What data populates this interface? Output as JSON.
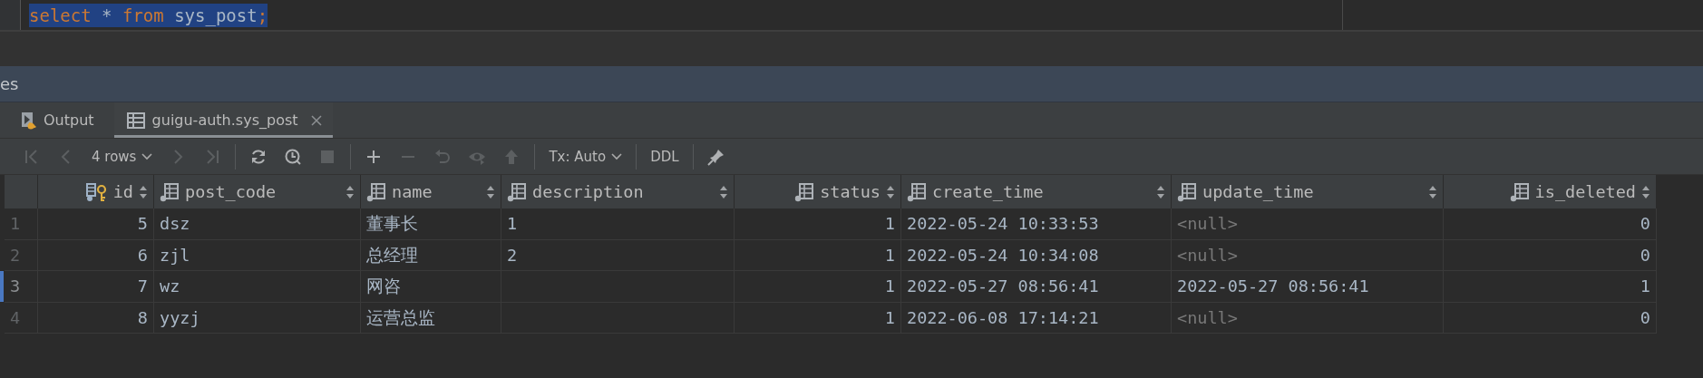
{
  "editor": {
    "selected": true,
    "tokens": [
      {
        "text": "select",
        "kind": "keyword",
        "space_before": false
      },
      {
        "text": "*",
        "kind": "plain",
        "space_before": true
      },
      {
        "text": "from",
        "kind": "keyword",
        "space_before": true
      },
      {
        "text": "sys_post",
        "kind": "plain",
        "space_before": true
      },
      {
        "text": ";",
        "kind": "keyword",
        "space_before": false
      }
    ]
  },
  "panel": {
    "title": "es"
  },
  "tabs": [
    {
      "label": "Output",
      "kind": "output",
      "selected": false,
      "closable": false
    },
    {
      "label": "guigu-auth.sys_post",
      "kind": "table",
      "selected": true,
      "closable": true
    }
  ],
  "toolbar": [
    {
      "kind": "first",
      "disabled": true
    },
    {
      "kind": "prev",
      "disabled": true
    },
    {
      "kind": "dropdown",
      "label": "4 rows",
      "disabled": false
    },
    {
      "kind": "next",
      "disabled": true
    },
    {
      "kind": "last",
      "disabled": true
    },
    {
      "kind": "separator"
    },
    {
      "kind": "refresh",
      "disabled": false
    },
    {
      "kind": "history",
      "disabled": false
    },
    {
      "kind": "stop",
      "disabled": true
    },
    {
      "kind": "separator"
    },
    {
      "kind": "add",
      "disabled": false
    },
    {
      "kind": "remove",
      "disabled": true
    },
    {
      "kind": "undo",
      "disabled": true
    },
    {
      "kind": "revert",
      "disabled": true
    },
    {
      "kind": "submit",
      "disabled": true
    },
    {
      "kind": "separator"
    },
    {
      "kind": "dropdown",
      "label": "Tx: Auto",
      "disabled": false
    },
    {
      "kind": "separator"
    },
    {
      "kind": "text",
      "label": "DDL",
      "disabled": false
    },
    {
      "kind": "separator"
    },
    {
      "kind": "pin",
      "disabled": false
    }
  ],
  "table": {
    "columns": [
      {
        "label": "id",
        "key": true,
        "kind": "number"
      },
      {
        "label": "post_code",
        "key": false,
        "kind": "text"
      },
      {
        "label": "name",
        "key": false,
        "kind": "text"
      },
      {
        "label": "description",
        "key": false,
        "kind": "text"
      },
      {
        "label": "status",
        "key": false,
        "kind": "number"
      },
      {
        "label": "create_time",
        "key": false,
        "kind": "text"
      },
      {
        "label": "update_time",
        "key": false,
        "kind": "text"
      },
      {
        "label": "is_deleted",
        "key": false,
        "kind": "number"
      }
    ],
    "rows": [
      {
        "number": "1",
        "current": false,
        "cells": [
          "5",
          "dsz",
          "董事长",
          "1",
          "1",
          "2022-05-24 10:33:53",
          "<null>",
          "0"
        ],
        "update_time_null": true
      },
      {
        "number": "2",
        "current": false,
        "cells": [
          "6",
          "zjl",
          "总经理",
          "2",
          "1",
          "2022-05-24 10:34:08",
          "<null>",
          "0"
        ],
        "update_time_null": true
      },
      {
        "number": "3",
        "current": true,
        "cells": [
          "7",
          "wz",
          "网咨",
          null,
          "1",
          "2022-05-27 08:56:41",
          "2022-05-27 08:56:41",
          "1"
        ],
        "update_time_null": false
      },
      {
        "number": "4",
        "current": false,
        "cells": [
          "8",
          "yyzj",
          "运营总监",
          null,
          "1",
          "2022-06-08 17:14:21",
          "<null>",
          "0"
        ],
        "update_time_null": true
      }
    ]
  }
}
